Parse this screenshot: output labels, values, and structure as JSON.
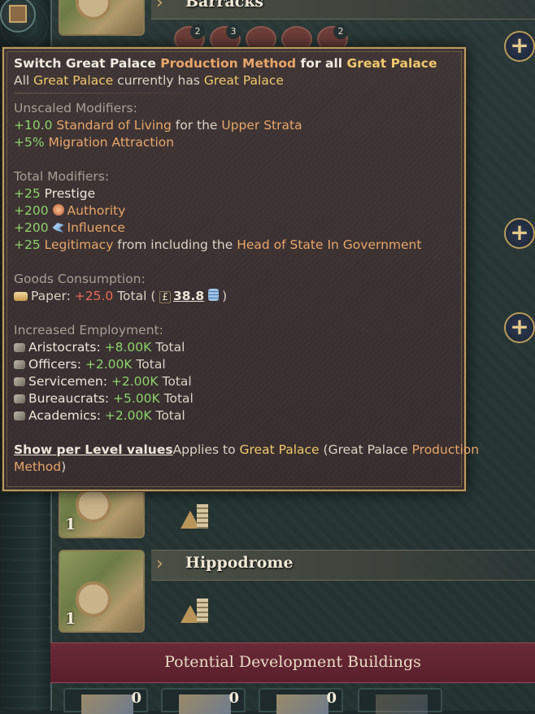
{
  "buildings": {
    "barracks": {
      "name": "Barracks",
      "unit_counts": [
        "2",
        "3",
        "",
        "",
        "2"
      ]
    },
    "hidden_row": {
      "level": "1"
    },
    "hippodrome": {
      "name": "Hippodrome",
      "level": "1"
    }
  },
  "potential": {
    "title": "Potential Development Buildings",
    "counts": [
      "0",
      "0",
      "0",
      ""
    ]
  },
  "add_button_label": "+",
  "tooltip": {
    "title": {
      "switch": "Switch Great Palace ",
      "pm": "Production Method",
      "for_all": " for all ",
      "bld": "Great Palace"
    },
    "subtitle": {
      "all": "All ",
      "bld": "Great Palace",
      "has": " currently has ",
      "pm": "Great Palace"
    },
    "unscaled": {
      "header": "Unscaled Modifiers:",
      "line1": {
        "value": "+10.0",
        "sol": " Standard of Living",
        "for": " for the ",
        "strata": "Upper Strata"
      },
      "line2": {
        "value": "+5%",
        "label": " Migration Attraction"
      }
    },
    "total": {
      "header": "Total Modifiers:",
      "prestige": {
        "value": "+25",
        "label": " Prestige"
      },
      "authority": {
        "value": "+200",
        "label": "Authority"
      },
      "influence": {
        "value": "+200",
        "label": "Influence"
      },
      "legitimacy": {
        "value": "+25",
        "label": " Legitimacy",
        "mid": " from including the ",
        "hos": "Head of State In Government"
      }
    },
    "goods": {
      "header": "Goods Consumption:",
      "paper": {
        "label": "Paper: ",
        "value": "+25.0",
        "total": " Total (",
        "pound": "£",
        "cost": "38.8",
        "close": ")"
      }
    },
    "employment": {
      "header": "Increased Employment:",
      "rows": [
        {
          "label": "Aristocrats: ",
          "value": "+8.00K",
          "suffix": " Total"
        },
        {
          "label": "Officers: ",
          "value": "+2.00K",
          "suffix": " Total"
        },
        {
          "label": "Servicemen: ",
          "value": "+2.00K",
          "suffix": " Total"
        },
        {
          "label": "Bureaucrats: ",
          "value": "+5.00K",
          "suffix": " Total"
        },
        {
          "label": "Academics: ",
          "value": "+2.00K",
          "suffix": " Total"
        }
      ]
    },
    "footer": {
      "link": "Show per Level values",
      "applies": "Applies to ",
      "bld": "Great Palace",
      "paren_open": " (Great Palace ",
      "pm1": "Production",
      "pm2": "Method",
      "paren_close": ")"
    }
  },
  "colors": {
    "positive": "#8cd36a",
    "negative": "#e86a55",
    "highlight": "#f0c86c",
    "border": "#b99b62"
  }
}
